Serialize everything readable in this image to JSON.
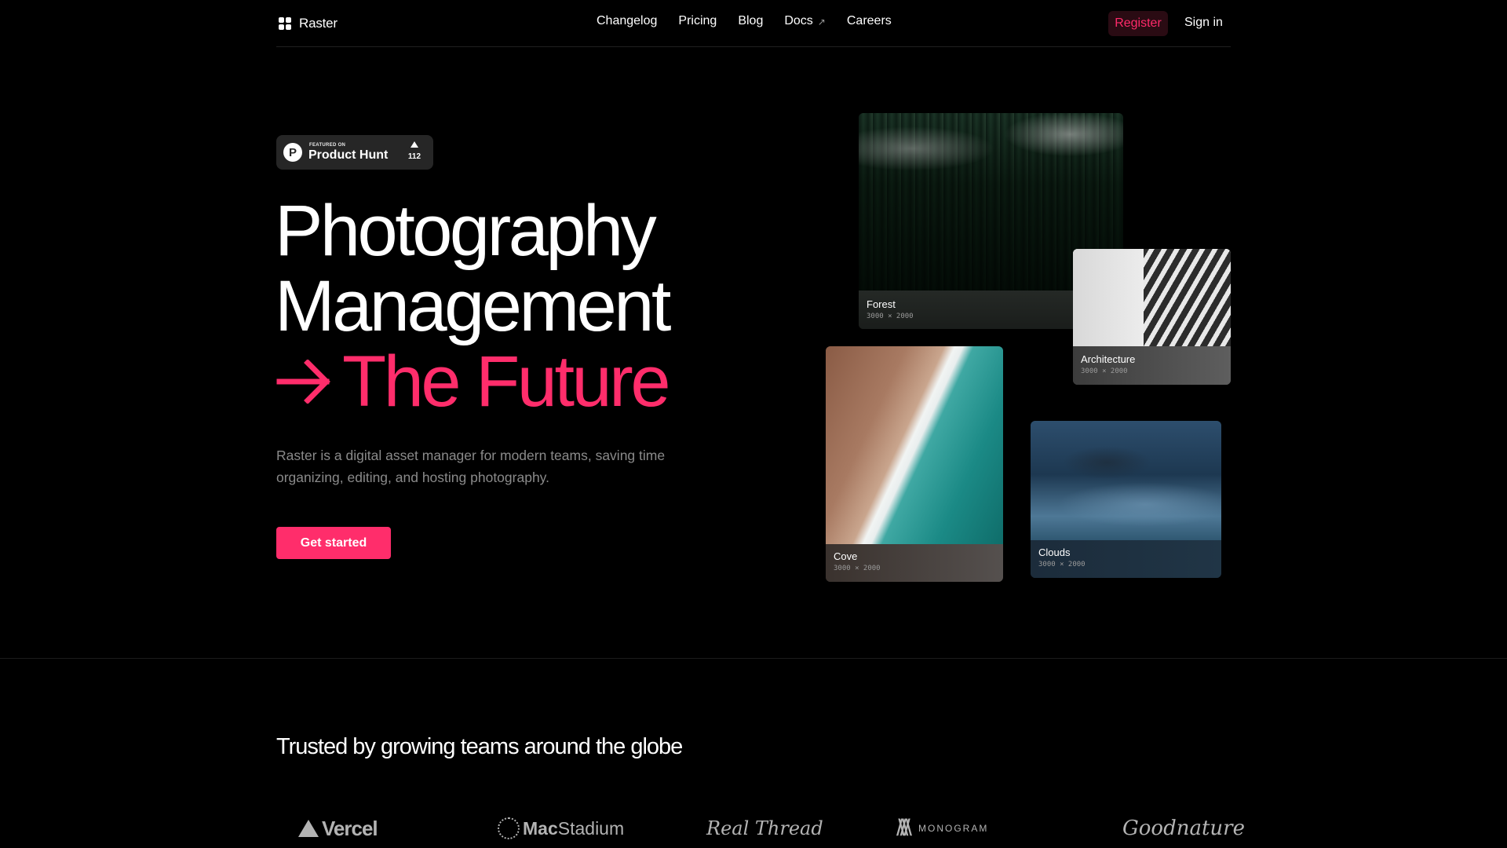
{
  "header": {
    "brand": "Raster",
    "nav": [
      "Changelog",
      "Pricing",
      "Blog",
      "Docs",
      "Careers"
    ],
    "register_label": "Register",
    "signin_label": "Sign in"
  },
  "product_hunt": {
    "featured": "FEATURED ON",
    "title": "Product Hunt",
    "upvotes": "112"
  },
  "hero": {
    "line1": "Photography",
    "line2": "Management",
    "line3": "The Future",
    "description": "Raster is a digital asset manager for modern teams, saving time organizing, editing, and hosting photography.",
    "cta_label": "Get started"
  },
  "cards": {
    "forest": {
      "title": "Forest",
      "dims": "3000 × 2000"
    },
    "architecture": {
      "title": "Architecture",
      "dims": "3000 × 2000"
    },
    "cove": {
      "title": "Cove",
      "dims": "3000 × 2000"
    },
    "clouds": {
      "title": "Clouds",
      "dims": "3000 × 2000"
    }
  },
  "trusted": {
    "heading": "Trusted by growing teams around the globe",
    "logos": {
      "vercel": "Vercel",
      "macstadium_bold": "Mac",
      "macstadium_rest": "Stadium",
      "realthread": "Real Thread",
      "monogram": "MONOGRAM",
      "goodnature": "Goodnature"
    }
  },
  "colors": {
    "accent": "#ff2d6b",
    "background": "#000000",
    "muted_text": "#8a8a8a"
  }
}
